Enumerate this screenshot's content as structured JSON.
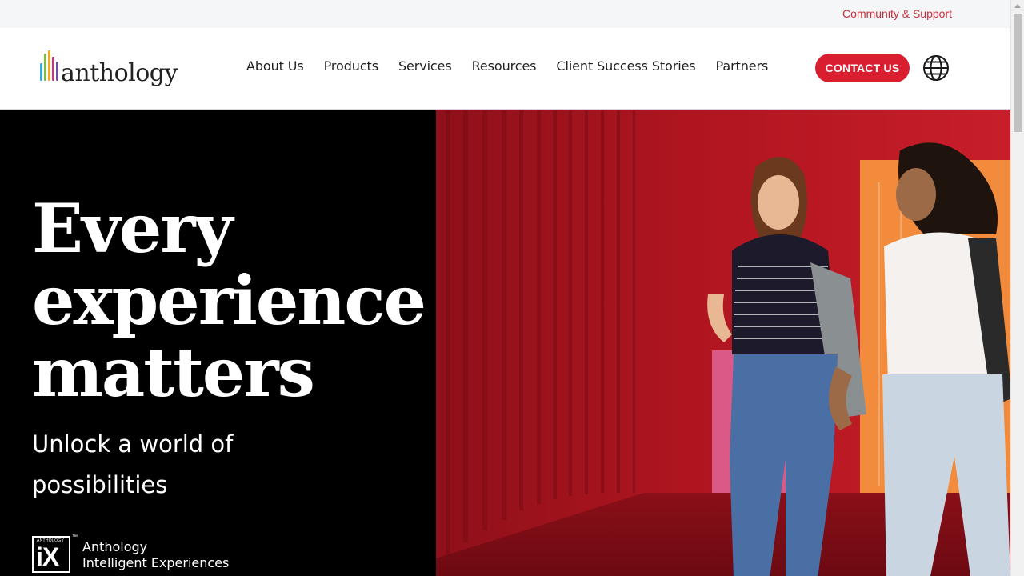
{
  "utility": {
    "community_link": "Community & Support"
  },
  "brand": {
    "logo_text": "anthology",
    "logo_bar_colors": [
      "#3aa9df",
      "#7ac143",
      "#f5a623",
      "#c0397f",
      "#6a52a3",
      "#d91f2f"
    ]
  },
  "nav": {
    "items": [
      {
        "label": "About Us"
      },
      {
        "label": "Products"
      },
      {
        "label": "Services"
      },
      {
        "label": "Resources"
      },
      {
        "label": "Client Success Stories"
      },
      {
        "label": "Partners"
      }
    ],
    "contact_label": "CONTACT US",
    "globe_icon": "globe-icon"
  },
  "hero": {
    "title_lines": [
      "Every",
      "experience",
      "matters"
    ],
    "subtitle": "Unlock a world of possibilities",
    "badge": {
      "small_text": "ANTHOLOGY",
      "mark": "iX",
      "tm": "™",
      "line1": "Anthology",
      "line2": "Intelligent Experiences"
    }
  },
  "colors": {
    "accent": "#d91f2f",
    "utility_link": "#c8303c",
    "hero_left_bg": "#000000",
    "hero_right_bg": "#a3151f",
    "orange_panel": "#f28b3c"
  }
}
